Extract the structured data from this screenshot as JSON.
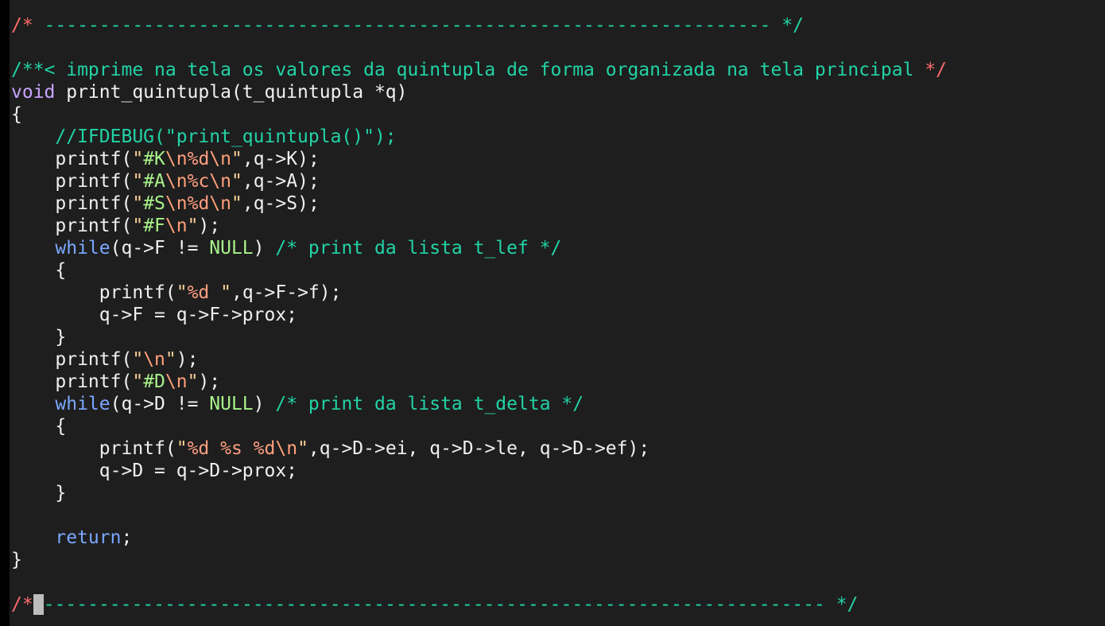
{
  "lines": [
    [
      {
        "t": "/* ",
        "c": "comment-star"
      },
      {
        "t": "------------------------------------------------------------------ ",
        "c": "comment"
      },
      {
        "t": "*/",
        "c": "comment"
      }
    ],
    [],
    [
      {
        "t": "/**< imprime na tela os valores da quintupla de forma organizada na tela principal ",
        "c": "comment"
      },
      {
        "t": "*/",
        "c": "comment-star"
      }
    ],
    [
      {
        "t": "void",
        "c": "type"
      },
      {
        "t": " print_quintupla(t_quintupla *q)",
        "c": "plain"
      }
    ],
    [
      {
        "t": "{",
        "c": "plain"
      }
    ],
    [
      {
        "t": "    //IFDEBUG(\"print_quintupla()\");",
        "c": "comment"
      }
    ],
    [
      {
        "t": "    printf(",
        "c": "plain"
      },
      {
        "t": "\"",
        "c": "string"
      },
      {
        "t": "#K",
        "c": "string-b"
      },
      {
        "t": "\\n",
        "c": "escape"
      },
      {
        "t": "%d",
        "c": "fmt"
      },
      {
        "t": "\\n",
        "c": "escape"
      },
      {
        "t": "\"",
        "c": "string"
      },
      {
        "t": ",q->K);",
        "c": "plain"
      }
    ],
    [
      {
        "t": "    printf(",
        "c": "plain"
      },
      {
        "t": "\"",
        "c": "string"
      },
      {
        "t": "#A",
        "c": "string-b"
      },
      {
        "t": "\\n",
        "c": "escape"
      },
      {
        "t": "%c",
        "c": "fmt"
      },
      {
        "t": "\\n",
        "c": "escape"
      },
      {
        "t": "\"",
        "c": "string"
      },
      {
        "t": ",q->A);",
        "c": "plain"
      }
    ],
    [
      {
        "t": "    printf(",
        "c": "plain"
      },
      {
        "t": "\"",
        "c": "string"
      },
      {
        "t": "#S",
        "c": "string-b"
      },
      {
        "t": "\\n",
        "c": "escape"
      },
      {
        "t": "%d",
        "c": "fmt"
      },
      {
        "t": "\\n",
        "c": "escape"
      },
      {
        "t": "\"",
        "c": "string"
      },
      {
        "t": ",q->S);",
        "c": "plain"
      }
    ],
    [
      {
        "t": "    printf(",
        "c": "plain"
      },
      {
        "t": "\"",
        "c": "string"
      },
      {
        "t": "#F",
        "c": "string-b"
      },
      {
        "t": "\\n",
        "c": "escape"
      },
      {
        "t": "\"",
        "c": "string"
      },
      {
        "t": ");",
        "c": "plain"
      }
    ],
    [
      {
        "t": "    ",
        "c": "plain"
      },
      {
        "t": "while",
        "c": "keyword"
      },
      {
        "t": "(q->F != ",
        "c": "plain"
      },
      {
        "t": "NULL",
        "c": "null"
      },
      {
        "t": ") ",
        "c": "plain"
      },
      {
        "t": "/* print da lista t_lef */",
        "c": "comment"
      }
    ],
    [
      {
        "t": "    {",
        "c": "plain"
      }
    ],
    [
      {
        "t": "        printf(",
        "c": "plain"
      },
      {
        "t": "\"",
        "c": "string"
      },
      {
        "t": "%d",
        "c": "fmt"
      },
      {
        "t": " \"",
        "c": "string"
      },
      {
        "t": ",q->F->f);",
        "c": "plain"
      }
    ],
    [
      {
        "t": "        q->F = q->F->prox;",
        "c": "plain"
      }
    ],
    [
      {
        "t": "    }",
        "c": "plain"
      }
    ],
    [
      {
        "t": "    printf(",
        "c": "plain"
      },
      {
        "t": "\"",
        "c": "string"
      },
      {
        "t": "\\n",
        "c": "escape"
      },
      {
        "t": "\"",
        "c": "string"
      },
      {
        "t": ");",
        "c": "plain"
      }
    ],
    [
      {
        "t": "    printf(",
        "c": "plain"
      },
      {
        "t": "\"",
        "c": "string"
      },
      {
        "t": "#D",
        "c": "string-b"
      },
      {
        "t": "\\n",
        "c": "escape"
      },
      {
        "t": "\"",
        "c": "string"
      },
      {
        "t": ");",
        "c": "plain"
      }
    ],
    [
      {
        "t": "    ",
        "c": "plain"
      },
      {
        "t": "while",
        "c": "keyword"
      },
      {
        "t": "(q->D != ",
        "c": "plain"
      },
      {
        "t": "NULL",
        "c": "null"
      },
      {
        "t": ") ",
        "c": "plain"
      },
      {
        "t": "/* print da lista t_delta */",
        "c": "comment"
      }
    ],
    [
      {
        "t": "    {",
        "c": "plain"
      }
    ],
    [
      {
        "t": "        printf(",
        "c": "plain"
      },
      {
        "t": "\"",
        "c": "string"
      },
      {
        "t": "%d %s %d",
        "c": "fmt"
      },
      {
        "t": "\\n",
        "c": "escape"
      },
      {
        "t": "\"",
        "c": "string"
      },
      {
        "t": ",q->D->ei, q->D->le, q->D->ef);",
        "c": "plain"
      }
    ],
    [
      {
        "t": "        q->D = q->D->prox;",
        "c": "plain"
      }
    ],
    [
      {
        "t": "    }",
        "c": "plain"
      }
    ],
    [],
    [
      {
        "t": "    ",
        "c": "plain"
      },
      {
        "t": "return",
        "c": "keyword"
      },
      {
        "t": ";",
        "c": "plain"
      }
    ],
    [
      {
        "t": "}",
        "c": "plain"
      }
    ],
    [],
    [
      {
        "t": "/*",
        "c": "comment-star"
      },
      {
        "cursor": true
      },
      {
        "t": "----------------------------------------------------------------------- ",
        "c": "comment"
      },
      {
        "t": "*/",
        "c": "comment"
      }
    ]
  ]
}
